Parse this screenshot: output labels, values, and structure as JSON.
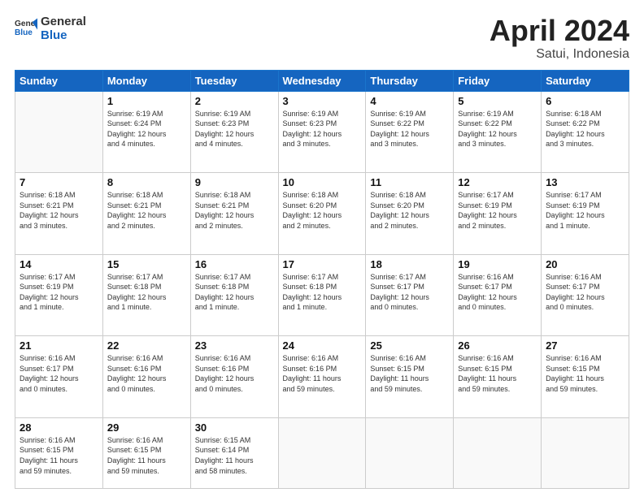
{
  "logo": {
    "line1": "General",
    "line2": "Blue"
  },
  "title": "April 2024",
  "subtitle": "Satui, Indonesia",
  "header_days": [
    "Sunday",
    "Monday",
    "Tuesday",
    "Wednesday",
    "Thursday",
    "Friday",
    "Saturday"
  ],
  "weeks": [
    [
      {
        "day": "",
        "info": ""
      },
      {
        "day": "1",
        "info": "Sunrise: 6:19 AM\nSunset: 6:24 PM\nDaylight: 12 hours\nand 4 minutes."
      },
      {
        "day": "2",
        "info": "Sunrise: 6:19 AM\nSunset: 6:23 PM\nDaylight: 12 hours\nand 4 minutes."
      },
      {
        "day": "3",
        "info": "Sunrise: 6:19 AM\nSunset: 6:23 PM\nDaylight: 12 hours\nand 3 minutes."
      },
      {
        "day": "4",
        "info": "Sunrise: 6:19 AM\nSunset: 6:22 PM\nDaylight: 12 hours\nand 3 minutes."
      },
      {
        "day": "5",
        "info": "Sunrise: 6:19 AM\nSunset: 6:22 PM\nDaylight: 12 hours\nand 3 minutes."
      },
      {
        "day": "6",
        "info": "Sunrise: 6:18 AM\nSunset: 6:22 PM\nDaylight: 12 hours\nand 3 minutes."
      }
    ],
    [
      {
        "day": "7",
        "info": "Sunrise: 6:18 AM\nSunset: 6:21 PM\nDaylight: 12 hours\nand 3 minutes."
      },
      {
        "day": "8",
        "info": "Sunrise: 6:18 AM\nSunset: 6:21 PM\nDaylight: 12 hours\nand 2 minutes."
      },
      {
        "day": "9",
        "info": "Sunrise: 6:18 AM\nSunset: 6:21 PM\nDaylight: 12 hours\nand 2 minutes."
      },
      {
        "day": "10",
        "info": "Sunrise: 6:18 AM\nSunset: 6:20 PM\nDaylight: 12 hours\nand 2 minutes."
      },
      {
        "day": "11",
        "info": "Sunrise: 6:18 AM\nSunset: 6:20 PM\nDaylight: 12 hours\nand 2 minutes."
      },
      {
        "day": "12",
        "info": "Sunrise: 6:17 AM\nSunset: 6:19 PM\nDaylight: 12 hours\nand 2 minutes."
      },
      {
        "day": "13",
        "info": "Sunrise: 6:17 AM\nSunset: 6:19 PM\nDaylight: 12 hours\nand 1 minute."
      }
    ],
    [
      {
        "day": "14",
        "info": "Sunrise: 6:17 AM\nSunset: 6:19 PM\nDaylight: 12 hours\nand 1 minute."
      },
      {
        "day": "15",
        "info": "Sunrise: 6:17 AM\nSunset: 6:18 PM\nDaylight: 12 hours\nand 1 minute."
      },
      {
        "day": "16",
        "info": "Sunrise: 6:17 AM\nSunset: 6:18 PM\nDaylight: 12 hours\nand 1 minute."
      },
      {
        "day": "17",
        "info": "Sunrise: 6:17 AM\nSunset: 6:18 PM\nDaylight: 12 hours\nand 1 minute."
      },
      {
        "day": "18",
        "info": "Sunrise: 6:17 AM\nSunset: 6:17 PM\nDaylight: 12 hours\nand 0 minutes."
      },
      {
        "day": "19",
        "info": "Sunrise: 6:16 AM\nSunset: 6:17 PM\nDaylight: 12 hours\nand 0 minutes."
      },
      {
        "day": "20",
        "info": "Sunrise: 6:16 AM\nSunset: 6:17 PM\nDaylight: 12 hours\nand 0 minutes."
      }
    ],
    [
      {
        "day": "21",
        "info": "Sunrise: 6:16 AM\nSunset: 6:17 PM\nDaylight: 12 hours\nand 0 minutes."
      },
      {
        "day": "22",
        "info": "Sunrise: 6:16 AM\nSunset: 6:16 PM\nDaylight: 12 hours\nand 0 minutes."
      },
      {
        "day": "23",
        "info": "Sunrise: 6:16 AM\nSunset: 6:16 PM\nDaylight: 12 hours\nand 0 minutes."
      },
      {
        "day": "24",
        "info": "Sunrise: 6:16 AM\nSunset: 6:16 PM\nDaylight: 11 hours\nand 59 minutes."
      },
      {
        "day": "25",
        "info": "Sunrise: 6:16 AM\nSunset: 6:15 PM\nDaylight: 11 hours\nand 59 minutes."
      },
      {
        "day": "26",
        "info": "Sunrise: 6:16 AM\nSunset: 6:15 PM\nDaylight: 11 hours\nand 59 minutes."
      },
      {
        "day": "27",
        "info": "Sunrise: 6:16 AM\nSunset: 6:15 PM\nDaylight: 11 hours\nand 59 minutes."
      }
    ],
    [
      {
        "day": "28",
        "info": "Sunrise: 6:16 AM\nSunset: 6:15 PM\nDaylight: 11 hours\nand 59 minutes."
      },
      {
        "day": "29",
        "info": "Sunrise: 6:16 AM\nSunset: 6:15 PM\nDaylight: 11 hours\nand 59 minutes."
      },
      {
        "day": "30",
        "info": "Sunrise: 6:15 AM\nSunset: 6:14 PM\nDaylight: 11 hours\nand 58 minutes."
      },
      {
        "day": "",
        "info": ""
      },
      {
        "day": "",
        "info": ""
      },
      {
        "day": "",
        "info": ""
      },
      {
        "day": "",
        "info": ""
      }
    ]
  ]
}
